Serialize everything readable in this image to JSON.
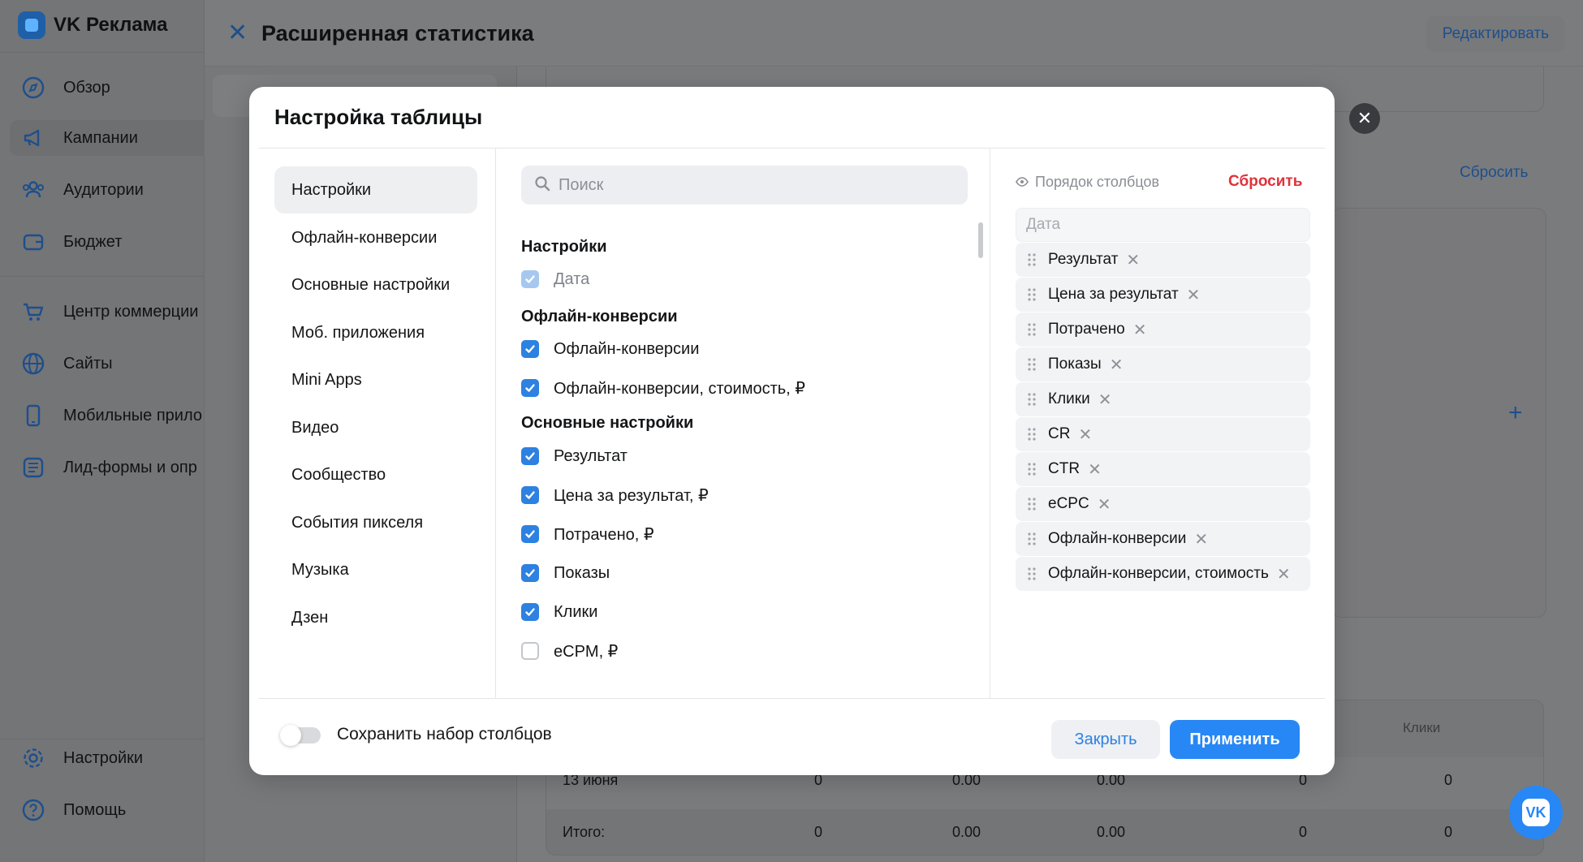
{
  "app": {
    "brand": "VK Реклама",
    "page_title": "Расширенная статистика",
    "edit_label": "Редактировать"
  },
  "sidebar": {
    "items": [
      {
        "label": "Обзор",
        "icon": "compass-icon"
      },
      {
        "label": "Кампании",
        "icon": "megaphone-icon"
      },
      {
        "label": "Аудитории",
        "icon": "users-icon"
      },
      {
        "label": "Бюджет",
        "icon": "wallet-icon"
      },
      {
        "label": "Центр коммерции",
        "icon": "cart-icon"
      },
      {
        "label": "Сайты",
        "icon": "globe-icon"
      },
      {
        "label": "Мобильные прило",
        "icon": "phone-icon"
      },
      {
        "label": "Лид-формы и опр",
        "icon": "list-icon"
      }
    ],
    "bottom_items": [
      {
        "label": "Настройки",
        "icon": "gear-icon"
      },
      {
        "label": "Помощь",
        "icon": "help-icon"
      }
    ]
  },
  "background": {
    "reset_label": "Сбросить",
    "table": {
      "header_clicks": "Клики",
      "row": {
        "date": "13 июня",
        "v1": "0",
        "v2": "0.00",
        "v3": "0.00",
        "v4": "0",
        "v5": "0"
      },
      "total": {
        "label": "Итого:",
        "v1": "0",
        "v2": "0.00",
        "v3": "0.00",
        "v4": "0",
        "v5": "0"
      }
    }
  },
  "modal": {
    "title": "Настройка таблицы",
    "nav": [
      "Настройки",
      "Офлайн-конверсии",
      "Основные настройки",
      "Моб. приложения",
      "Mini Apps",
      "Видео",
      "Сообщество",
      "События пикселя",
      "Музыка",
      "Дзен"
    ],
    "search_placeholder": "Поиск",
    "sections": [
      {
        "title": "Настройки",
        "items": [
          {
            "label": "Дата",
            "state": "disabled"
          }
        ]
      },
      {
        "title": "Офлайн-конверсии",
        "items": [
          {
            "label": "Офлайн-конверсии",
            "state": "checked"
          },
          {
            "label": "Офлайн-конверсии, стоимость, ₽",
            "state": "checked"
          }
        ]
      },
      {
        "title": "Основные настройки",
        "items": [
          {
            "label": "Результат",
            "state": "checked"
          },
          {
            "label": "Цена за результат, ₽",
            "state": "checked"
          },
          {
            "label": "Потрачено, ₽",
            "state": "checked"
          },
          {
            "label": "Показы",
            "state": "checked"
          },
          {
            "label": "Клики",
            "state": "checked"
          },
          {
            "label": "eCPM, ₽",
            "state": "unchecked"
          }
        ]
      }
    ],
    "order_label": "Порядок столбцов",
    "order_reset": "Сбросить",
    "fixed_column": "Дата",
    "columns": [
      "Результат",
      "Цена за результат",
      "Потрачено",
      "Показы",
      "Клики",
      "CR",
      "CTR",
      "eCPC",
      "Офлайн-конверсии",
      "Офлайн-конверсии, стоимость"
    ],
    "save_toggle_label": "Сохранить набор столбцов",
    "save_toggle_on": false,
    "close_label": "Закрыть",
    "apply_label": "Применить"
  },
  "colors": {
    "accent": "#2787f5",
    "danger": "#e0323c",
    "checkbox": "#2d81e0"
  }
}
